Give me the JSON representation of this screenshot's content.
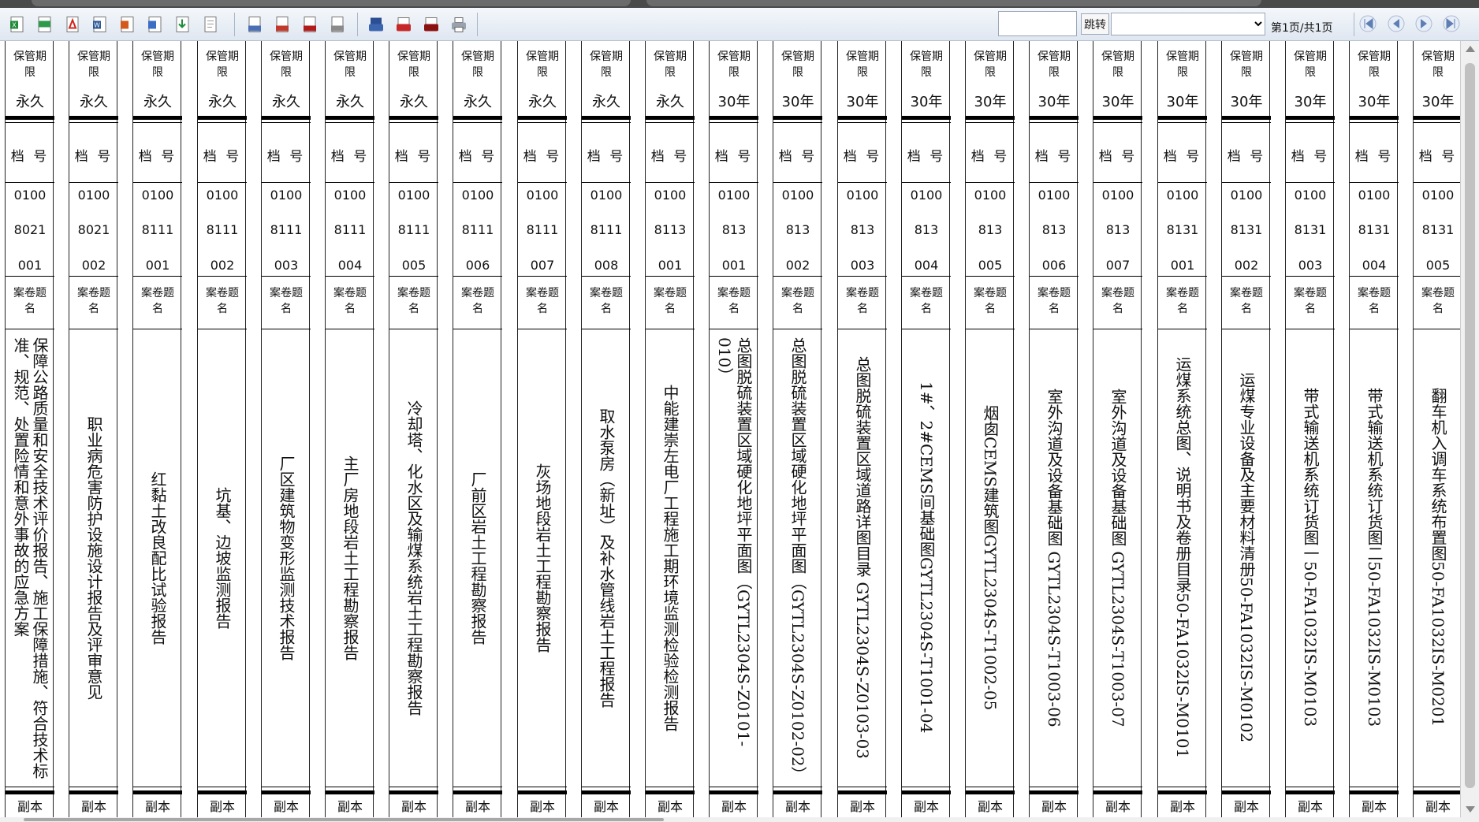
{
  "toolbar": {
    "export_icons": [
      "excel-icon",
      "excel-alt-icon",
      "pdf-icon",
      "word-icon",
      "ppt-icon",
      "outlook-icon",
      "download-icon",
      "text-icon"
    ],
    "print_icons": [
      "print-preview-icon",
      "print-pdf-preview-icon",
      "print-pdf-icon",
      "print-text-icon"
    ],
    "direct_print_icons": [
      "direct-print-icon",
      "print-pdf-red-icon",
      "print-pdf-dark-icon",
      "printer-icon"
    ],
    "page_input": "",
    "jump_label": "跳转",
    "page_select_value": "",
    "page_status": "第1页/共1页",
    "nav_icons": [
      "first-page-icon",
      "prev-page-icon",
      "next-page-icon",
      "last-page-icon"
    ]
  },
  "labels_common": {
    "retention_header": "保管期限",
    "file_no_header": "档 号",
    "title_header": "案卷题名",
    "copy_label": "副本"
  },
  "labels": [
    {
      "retention": "永久",
      "no1": "0100",
      "no2": "8021",
      "no3": "001",
      "title": "保障公路质量和安全技术评价报告、施工保障措施、符合技术标准、规范、处置险情和意外事故的应急方案"
    },
    {
      "retention": "永久",
      "no1": "0100",
      "no2": "8021",
      "no3": "002",
      "title": "职业病危害防护设施设计报告及评审意见"
    },
    {
      "retention": "永久",
      "no1": "0100",
      "no2": "8111",
      "no3": "001",
      "title": "红黏土改良配比试验报告"
    },
    {
      "retention": "永久",
      "no1": "0100",
      "no2": "8111",
      "no3": "002",
      "title": "坑基、边坡监测报告"
    },
    {
      "retention": "永久",
      "no1": "0100",
      "no2": "8111",
      "no3": "003",
      "title": "厂区建筑物变形监测技术报告"
    },
    {
      "retention": "永久",
      "no1": "0100",
      "no2": "8111",
      "no3": "004",
      "title": "主厂房地段岩土工程勘察报告"
    },
    {
      "retention": "永久",
      "no1": "0100",
      "no2": "8111",
      "no3": "005",
      "title": "冷却塔、化水区及输煤系统岩土工程勘察报告"
    },
    {
      "retention": "永久",
      "no1": "0100",
      "no2": "8111",
      "no3": "006",
      "title": "厂前区岩土工程勘察报告"
    },
    {
      "retention": "永久",
      "no1": "0100",
      "no2": "8111",
      "no3": "007",
      "title": "灰场地段岩土工程勘察报告"
    },
    {
      "retention": "永久",
      "no1": "0100",
      "no2": "8111",
      "no3": "008",
      "title": "取水泵房（新址）及补水管线岩土工程报告"
    },
    {
      "retention": "永久",
      "no1": "0100",
      "no2": "8113",
      "no3": "001",
      "title": "中能建崇左电厂工程施工期环境监测检验检测报告"
    },
    {
      "retention": "30年",
      "no1": "0100",
      "no2": "813",
      "no3": "001",
      "title": "总图脱硫装置区域硬化地坪平面图（GYTL2304S-Z0101-010）"
    },
    {
      "retention": "30年",
      "no1": "0100",
      "no2": "813",
      "no3": "002",
      "title": "总图脱硫装置区域硬化地坪平面图（GYTL2304S-Z0102-02）"
    },
    {
      "retention": "30年",
      "no1": "0100",
      "no2": "813",
      "no3": "003",
      "title": "总图脱硫装置区域道路详图目录 GYTL2304S-Z0103-03"
    },
    {
      "retention": "30年",
      "no1": "0100",
      "no2": "813",
      "no3": "004",
      "title": "1#、2#CEMS间基础图GYTL2304S-T1001-04"
    },
    {
      "retention": "30年",
      "no1": "0100",
      "no2": "813",
      "no3": "005",
      "title": "烟囱CEMS建筑图GYTL2304S-T1002-05"
    },
    {
      "retention": "30年",
      "no1": "0100",
      "no2": "813",
      "no3": "006",
      "title": "室外沟道及设备基础图 GYTL2304S-T1003-06"
    },
    {
      "retention": "30年",
      "no1": "0100",
      "no2": "813",
      "no3": "007",
      "title": "室外沟道及设备基础图 GYTL2304S-T1003-07"
    },
    {
      "retention": "30年",
      "no1": "0100",
      "no2": "8131",
      "no3": "001",
      "title": "运煤系统总图、说明书及卷册目录50-FA1032IS-M0101"
    },
    {
      "retention": "30年",
      "no1": "0100",
      "no2": "8131",
      "no3": "002",
      "title": "运煤专业设备及主要材料清册50-FA1032IS-M0102"
    },
    {
      "retention": "30年",
      "no1": "0100",
      "no2": "8131",
      "no3": "003",
      "title": "带式输送机系统订货图一50-FA1032IS-M0103"
    },
    {
      "retention": "30年",
      "no1": "0100",
      "no2": "8131",
      "no3": "004",
      "title": "带式输送机系统订货图二50-FA1032IS-M0103"
    },
    {
      "retention": "30年",
      "no1": "0100",
      "no2": "8131",
      "no3": "005",
      "title": "翻车机入调车系统布置图50-FA1032IS-M0201"
    }
  ]
}
